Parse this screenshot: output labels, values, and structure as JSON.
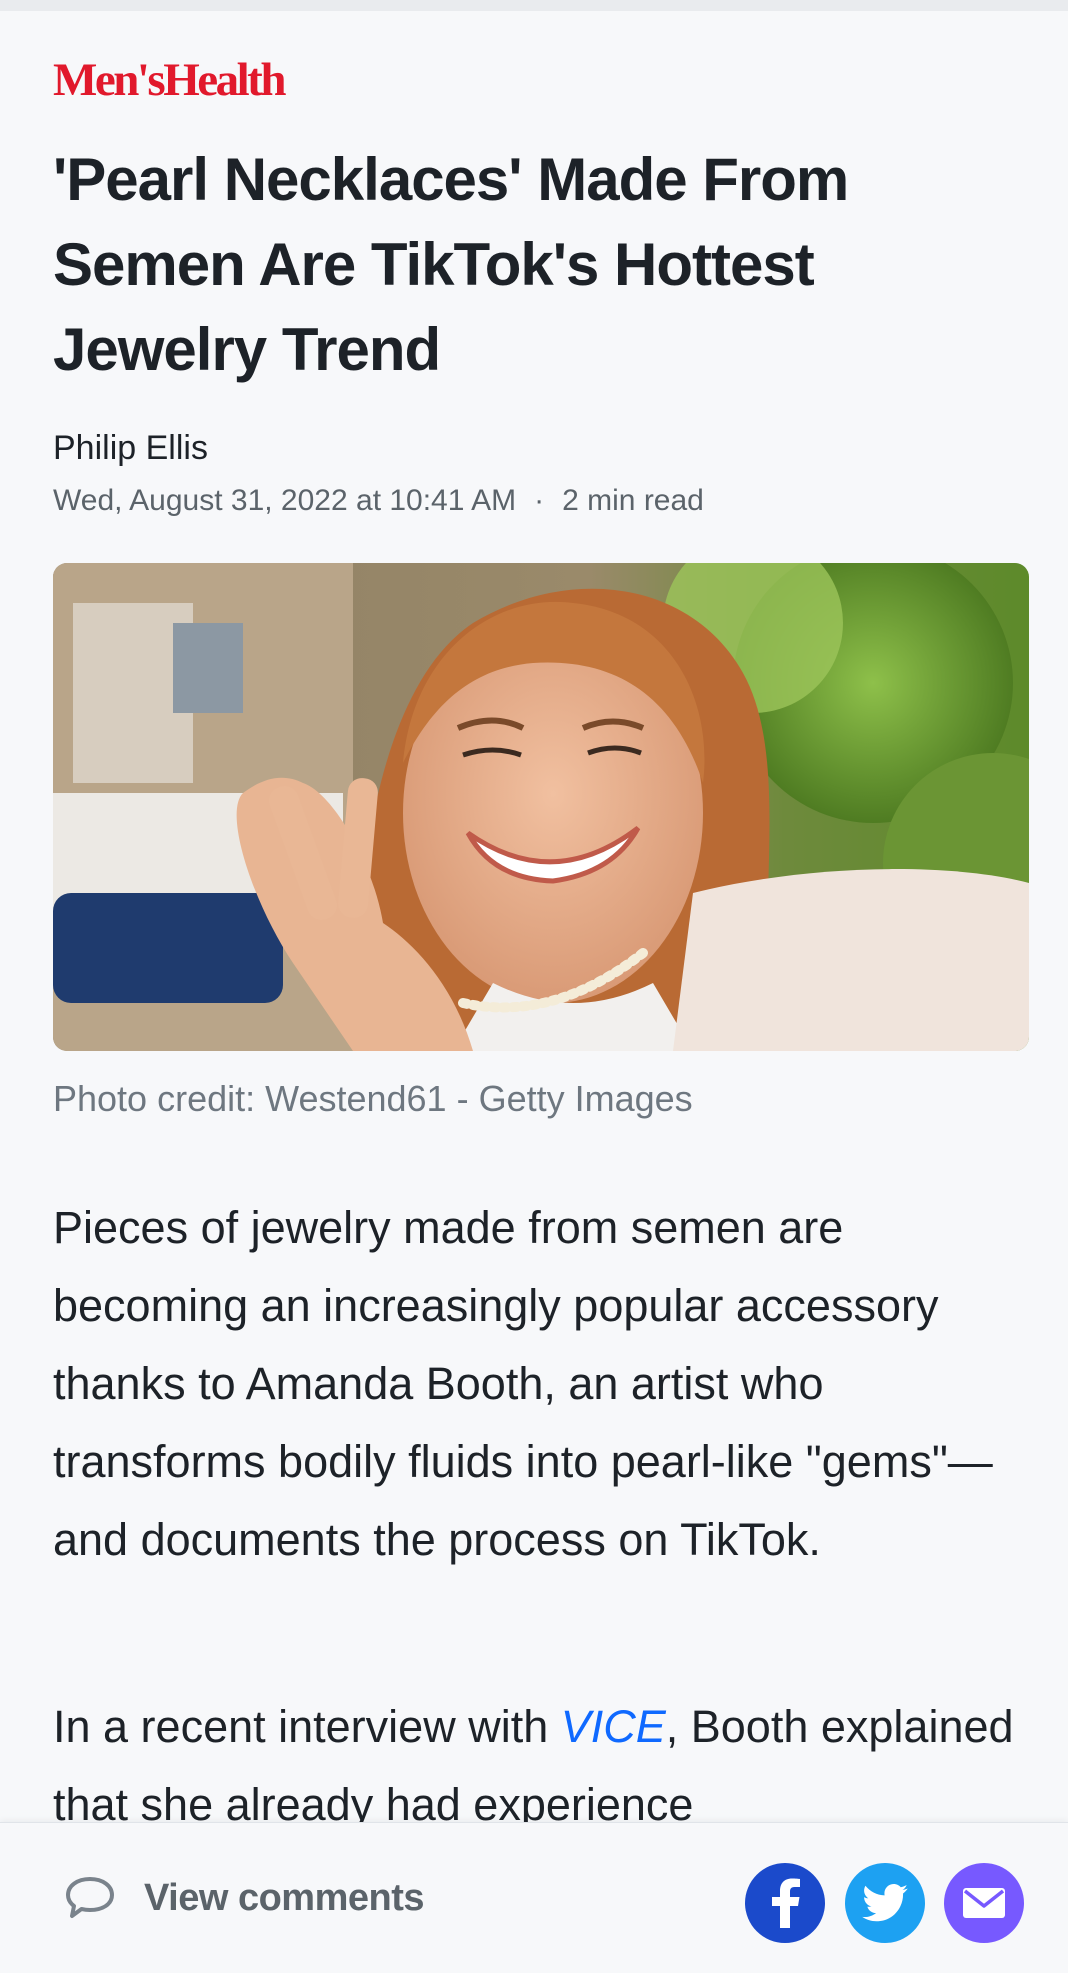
{
  "brand": {
    "name": "Men'sHealth",
    "color": "#e1192c"
  },
  "article": {
    "title": "'Pearl Necklaces' Made From Semen Are TikTok's Hottest Jewelry Trend",
    "author": "Philip Ellis",
    "date": "Wed, August 31, 2022 at 10:41 AM",
    "separator": "·",
    "read_time": "2 min read",
    "photo_credit": "Photo credit: Westend61 - Getty Images",
    "paragraph1": "Pieces of jewelry made from semen are becoming an increasingly popular accessory thanks to Amanda Booth, an artist who transforms bodily fluids into pearl-like \"gems\"—and documents the process on TikTok.",
    "paragraph2_before": "In a recent interview with ",
    "paragraph2_link": "VICE",
    "paragraph2_after": ", Booth explained that she already had experience"
  },
  "footer": {
    "comments_label": "View comments",
    "comments_icon": "speech-bubble-icon",
    "share_buttons": [
      {
        "icon": "facebook-icon",
        "color": "#1b4acb"
      },
      {
        "icon": "twitter-icon",
        "color": "#1da1f2"
      },
      {
        "icon": "mail-icon",
        "color": "#7759ff"
      }
    ]
  },
  "colors": {
    "link": "#0f69ff",
    "text": "#1d2228",
    "muted": "#5b636a"
  }
}
